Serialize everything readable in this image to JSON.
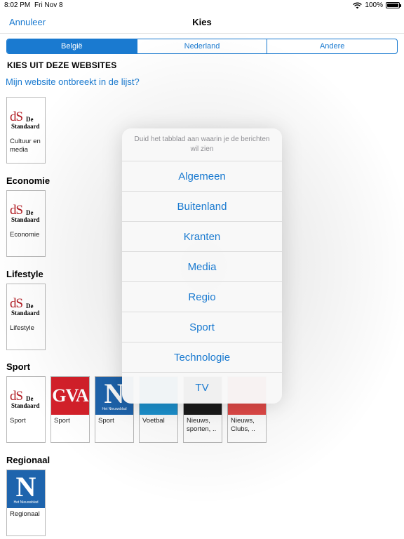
{
  "status": {
    "time": "8:02 PM",
    "date": "Fri Nov 8",
    "battery": "100%"
  },
  "nav": {
    "cancel": "Annuleer",
    "title": "Kies"
  },
  "tabs": [
    {
      "label": "België",
      "active": true
    },
    {
      "label": "Nederland",
      "active": false
    },
    {
      "label": "Andere",
      "active": false
    }
  ],
  "heading": "KIES UIT DEZE WEBSITES",
  "missing_link": "Mijn website ontbreekt in de lijst?",
  "logos": {
    "ds_top": "dS",
    "ds_de": "De",
    "ds_name": "Standaard",
    "gva": "GVA",
    "hn_letter": "N",
    "hn_sub": "Het Nieuwsblad"
  },
  "sections": {
    "cultuur": {
      "title": "",
      "tiles": [
        {
          "label": "Cultuur en media"
        }
      ]
    },
    "economie": {
      "title": "Economie",
      "tiles": [
        {
          "label": "Economie"
        }
      ]
    },
    "lifestyle": {
      "title": "Lifestyle",
      "tiles": [
        {
          "label": "Lifestyle"
        }
      ]
    },
    "sport": {
      "title": "Sport",
      "tiles": [
        {
          "label": "Sport"
        },
        {
          "label": "Sport"
        },
        {
          "label": "Sport"
        },
        {
          "label": "Voetbal"
        },
        {
          "label": "Nieuws, sporten, .."
        },
        {
          "label": "Nieuws, Clubs, .."
        }
      ]
    },
    "regionaal": {
      "title": "Regionaal",
      "tiles": [
        {
          "label": "Regionaal"
        }
      ]
    }
  },
  "popup": {
    "message": "Duid het tabblad aan waarin je de berichten wil zien",
    "options": [
      "Algemeen",
      "Buitenland",
      "Kranten",
      "Media",
      "Regio",
      "Sport",
      "Technologie",
      "TV"
    ]
  },
  "colors": {
    "accent": "#1a7ad0",
    "ds_red": "#b11b22",
    "gva_red": "#d4202a",
    "nieuwsblad_blue": "#1e64ad"
  }
}
